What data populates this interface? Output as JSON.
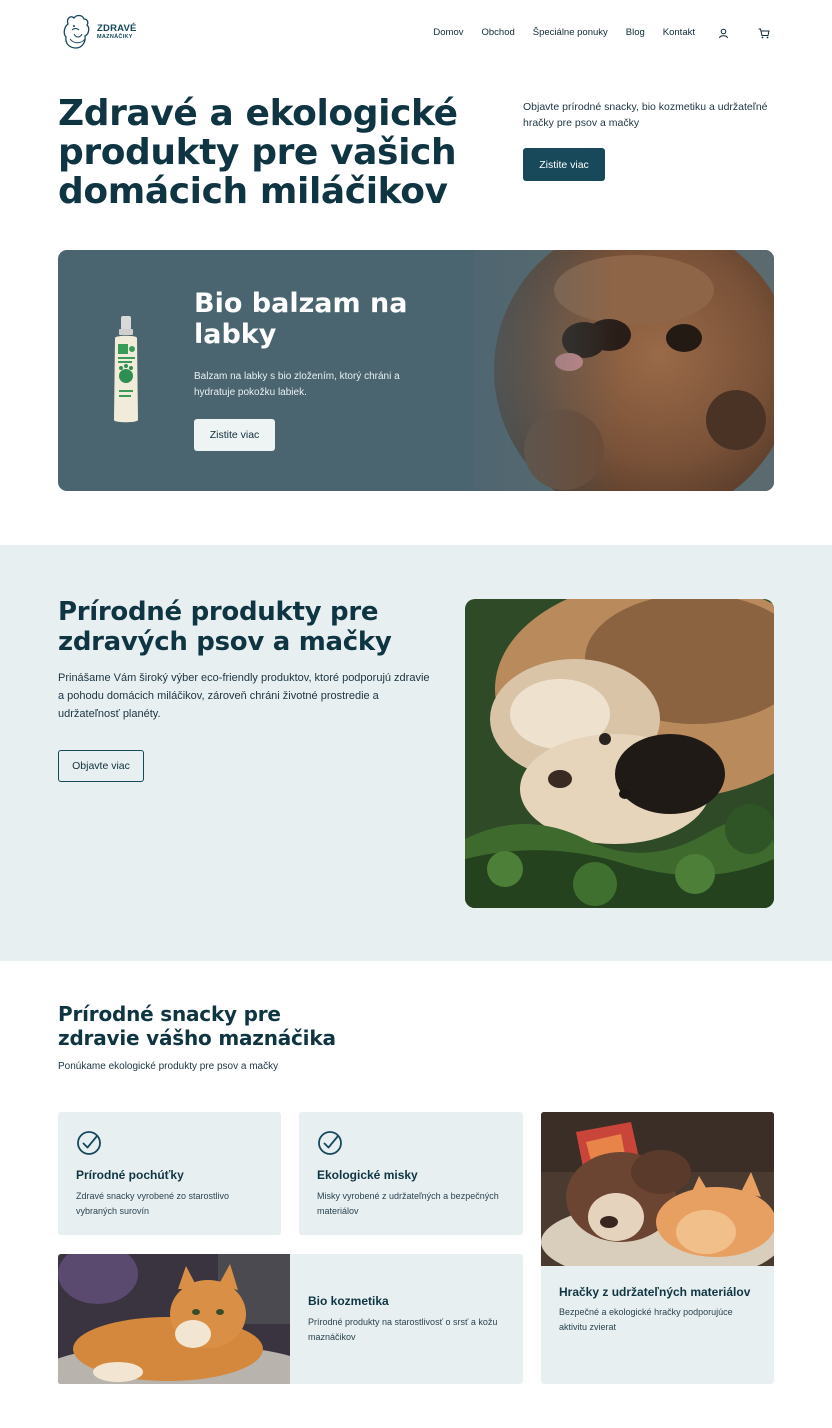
{
  "brand": {
    "name": "ZDRAVÉ",
    "sub": "MAZNÁČIKY"
  },
  "nav": {
    "items": [
      "Domov",
      "Obchod",
      "Špeciálne ponuky",
      "Blog",
      "Kontakt"
    ]
  },
  "hero": {
    "title": "Zdravé a ekologické produkty pre vašich domácich miláčikov",
    "description": "Objavte prírodné snacky, bio kozmetiku a udržateľné hračky pre psov a mačky",
    "button": "Zistite viac"
  },
  "banner": {
    "title": "Bio balzam na labky",
    "description": "Balzam na labky s bio zložením, ktorý chráni a hydratuje pokožku labiek.",
    "button": "Zistite viac"
  },
  "natural": {
    "title": "Prírodné produkty pre zdravých psov a mačky",
    "description": "Prinášame Vám široký výber eco-friendly produktov, ktoré podporujú zdravie a pohodu domácich miláčikov, zároveň chráni životné prostredie a udržateľnosť planéty.",
    "button": "Objavte viac"
  },
  "snacks": {
    "title": "Prírodné snacky pre zdravie vášho maznáčika",
    "description": "Ponúkame ekologické produkty pre psov a mačky",
    "cards": [
      {
        "title": "Prírodné pochúťky",
        "description": "Zdravé snacky vyrobené zo starostlivo vybraných surovín",
        "icon": "check-circle-icon"
      },
      {
        "title": "Ekologické misky",
        "description": "Misky vyrobené z udržateľných a bezpečných materiálov",
        "icon": "check-circle-icon"
      },
      {
        "title": "Hračky z udržateľných materiálov",
        "description": "Bezpečné a ekologické hračky podporujúce aktivitu zvierat"
      },
      {
        "title": "Bio kozmetika",
        "description": "Prírodné produkty na starostlivosť o srsť a kožu maznáčikov"
      }
    ]
  },
  "colors": {
    "primary": "#17495b",
    "section_bg": "#e8eff1",
    "banner_bg": "#4a6470",
    "text": "#0f3543"
  }
}
